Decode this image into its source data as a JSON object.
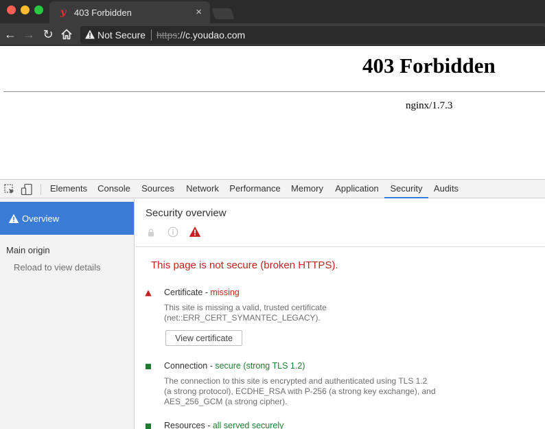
{
  "browser": {
    "tab_title": "403 Forbidden",
    "tab_favicon_letter": "y",
    "tab_close": "×",
    "nav_back": "←",
    "nav_forward": "→",
    "nav_reload": "↻",
    "omnibox_security_text": "Not Secure",
    "omnibox_scheme": "https",
    "omnibox_host": "://c.youdao.com"
  },
  "page": {
    "heading": "403 Forbidden",
    "server_signature": "nginx/1.7.3"
  },
  "devtools": {
    "tabs": [
      "Elements",
      "Console",
      "Sources",
      "Network",
      "Performance",
      "Memory",
      "Application",
      "Security",
      "Audits"
    ],
    "active_tab": "Security",
    "sidebar": {
      "overview_label": "Overview",
      "main_origin_label": "Main origin",
      "main_origin_item": "Reload to view details"
    },
    "main": {
      "title": "Security overview",
      "headline": "This page is not secure (broken HTTPS).",
      "explanations": [
        {
          "status": "insecure",
          "title": "Certificate",
          "summary": "missing",
          "description": [
            "This site is missing a valid, trusted certificate",
            "(net::ERR_CERT_SYMANTEC_LEGACY)."
          ],
          "button_label": "View certificate"
        },
        {
          "status": "secure",
          "title": "Connection",
          "summary": "secure (strong TLS 1.2)",
          "description": [
            "The connection to this site is encrypted and authenticated using TLS 1.2",
            "(a strong protocol), ECDHE_RSA with P-256 (a strong key exchange), and",
            "AES_256_GCM (a strong cipher)."
          ]
        },
        {
          "status": "secure",
          "title": "Resources",
          "summary": "all served securely"
        }
      ]
    }
  },
  "colors": {
    "insecure_red": "#c5221f",
    "secure_green": "#1e7d32",
    "devtools_selection_blue": "#3a7bd5"
  },
  "icons": {
    "omnibox": "warning-triangle-icon",
    "overview": "warning-triangle-icon",
    "certificate": "red-triangle-icon",
    "connection": "green-square-icon",
    "resources": "green-square-icon"
  }
}
